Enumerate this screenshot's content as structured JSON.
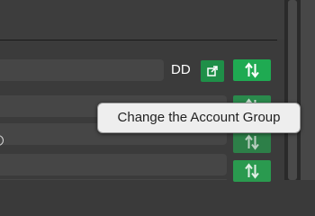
{
  "row": {
    "label": "DD"
  },
  "icons": {
    "export": "external-link-icon",
    "change_group": "swap-vertical-arrows-icon"
  },
  "tooltip": {
    "text": "Change the Account Group"
  },
  "colors": {
    "background": "#3b3b3b",
    "field": "#464646",
    "accent_green": "#1faa52",
    "export_green": "#1f8f48",
    "tooltip_bg": "#eeeeee",
    "tooltip_text": "#222222"
  }
}
